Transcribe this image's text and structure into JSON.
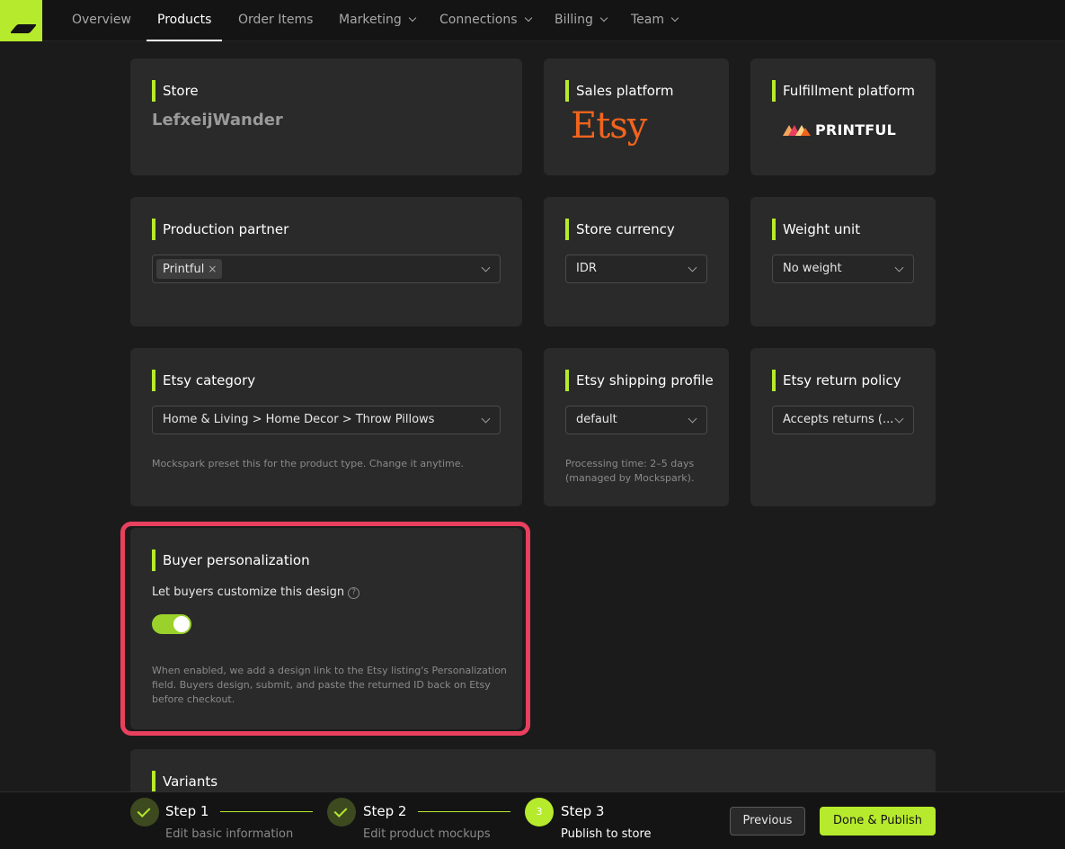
{
  "nav": {
    "items": [
      {
        "label": "Overview",
        "dropdown": false,
        "active": false
      },
      {
        "label": "Products",
        "dropdown": false,
        "active": true
      },
      {
        "label": "Order Items",
        "dropdown": false,
        "active": false
      },
      {
        "label": "Marketing",
        "dropdown": true,
        "active": false
      },
      {
        "label": "Connections",
        "dropdown": true,
        "active": false
      },
      {
        "label": "Billing",
        "dropdown": true,
        "active": false
      },
      {
        "label": "Team",
        "dropdown": true,
        "active": false
      }
    ]
  },
  "store": {
    "title": "Store",
    "name": "LefxeijWander"
  },
  "sales_platform": {
    "title": "Sales platform",
    "logo_text": "Etsy"
  },
  "fulfillment_platform": {
    "title": "Fulfillment platform",
    "logo_text": "PRINTFUL"
  },
  "production_partner": {
    "title": "Production partner",
    "tag": "Printful",
    "tag_remove": "×"
  },
  "store_currency": {
    "title": "Store currency",
    "value": "IDR"
  },
  "weight_unit": {
    "title": "Weight unit",
    "value": "No weight"
  },
  "etsy_category": {
    "title": "Etsy category",
    "value": "Home & Living > Home Decor > Throw Pillows",
    "help": "Mockspark preset this for the product type. Change it anytime."
  },
  "shipping_profile": {
    "title": "Etsy shipping profile",
    "value": "default",
    "help_line1": "Processing time: 2–5 days",
    "help_line2": "(managed by Mockspark)."
  },
  "return_policy": {
    "title": "Etsy return policy",
    "value": "Accepts returns (..."
  },
  "personalization": {
    "title": "Buyer personalization",
    "switch_label": "Let buyers customize this design",
    "help_icon": "?",
    "enabled": true,
    "help_line1": "When enabled, we add a design link to the Etsy listing's Personalization",
    "help_line2": "field. Buyers design, submit, and paste the returned ID back on Etsy",
    "help_line3": "before checkout."
  },
  "variants": {
    "title": "Variants"
  },
  "stepper": {
    "steps": [
      {
        "title": "Step 1",
        "subtitle": "Edit basic information",
        "state": "done"
      },
      {
        "title": "Step 2",
        "subtitle": "Edit product mockups",
        "state": "done"
      },
      {
        "title": "Step 3",
        "subtitle": "Publish to store",
        "state": "current",
        "number": "3"
      }
    ],
    "previous_label": "Previous",
    "done_label": "Done & Publish"
  },
  "colors": {
    "accent": "#b6ea2c",
    "toggle_on": "#9bd12b",
    "highlight": "#e8405e",
    "etsy_orange": "#f1641e",
    "card_bg": "#2a2a2a",
    "page_bg": "#1b1b1b"
  }
}
